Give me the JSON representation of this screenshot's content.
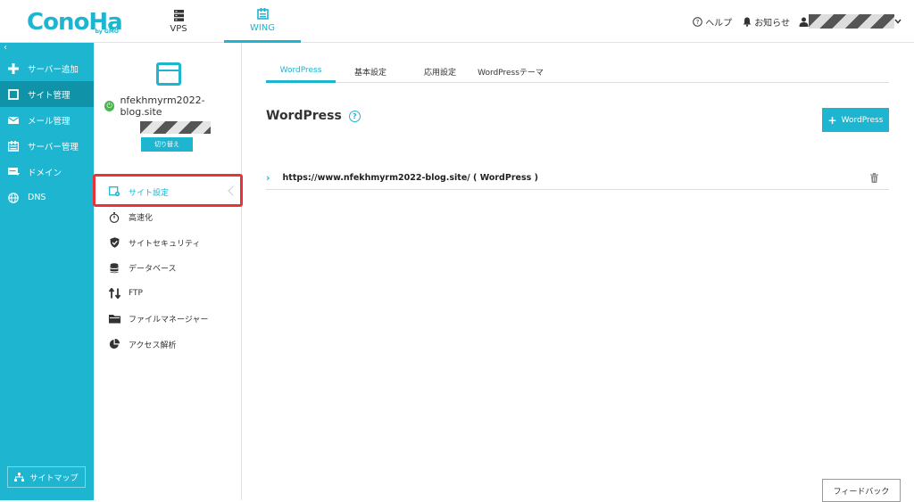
{
  "header": {
    "logo": "ConoHa",
    "logo_sub": "by GMO",
    "nav": [
      {
        "label": "VPS"
      },
      {
        "label": "WING"
      }
    ],
    "help_label": "ヘルプ",
    "notice_label": "お知らせ"
  },
  "sidebar": {
    "collapse_label": "‹",
    "items": [
      {
        "label": "サーバー追加",
        "icon": "plus-icon"
      },
      {
        "label": "サイト管理",
        "icon": "window-icon"
      },
      {
        "label": "メール管理",
        "icon": "mail-icon"
      },
      {
        "label": "サーバー管理",
        "icon": "server-icon"
      },
      {
        "label": "ドメイン",
        "icon": "domain-icon"
      },
      {
        "label": "DNS",
        "icon": "globe-icon"
      }
    ],
    "sitemap_label": "サイトマップ"
  },
  "site_panel": {
    "domain": "nfekhmyrm2022-blog.site",
    "switch_label": "切り替え",
    "menu": [
      {
        "label": "サイト設定",
        "icon": "site-settings-icon"
      },
      {
        "label": "高速化",
        "icon": "stopwatch-icon"
      },
      {
        "label": "サイトセキュリティ",
        "icon": "shield-icon"
      },
      {
        "label": "データベース",
        "icon": "database-icon"
      },
      {
        "label": "FTP",
        "icon": "transfer-icon"
      },
      {
        "label": "ファイルマネージャー",
        "icon": "folder-icon"
      },
      {
        "label": "アクセス解析",
        "icon": "pie-chart-icon"
      }
    ]
  },
  "main": {
    "tabs": [
      {
        "label": "WordPress"
      },
      {
        "label": "基本設定"
      },
      {
        "label": "応用設定"
      },
      {
        "label": "WordPressテーマ"
      }
    ],
    "title": "WordPress",
    "help_mark": "?",
    "add_button_label": "WordPress",
    "wp_url": "https://www.nfekhmyrm2022-blog.site/ ( WordPress )"
  },
  "feedback_label": "フィードバック",
  "colors": {
    "accent": "#1db5d0",
    "accent_dark": "#1092a9",
    "highlight": "#e8333a"
  }
}
